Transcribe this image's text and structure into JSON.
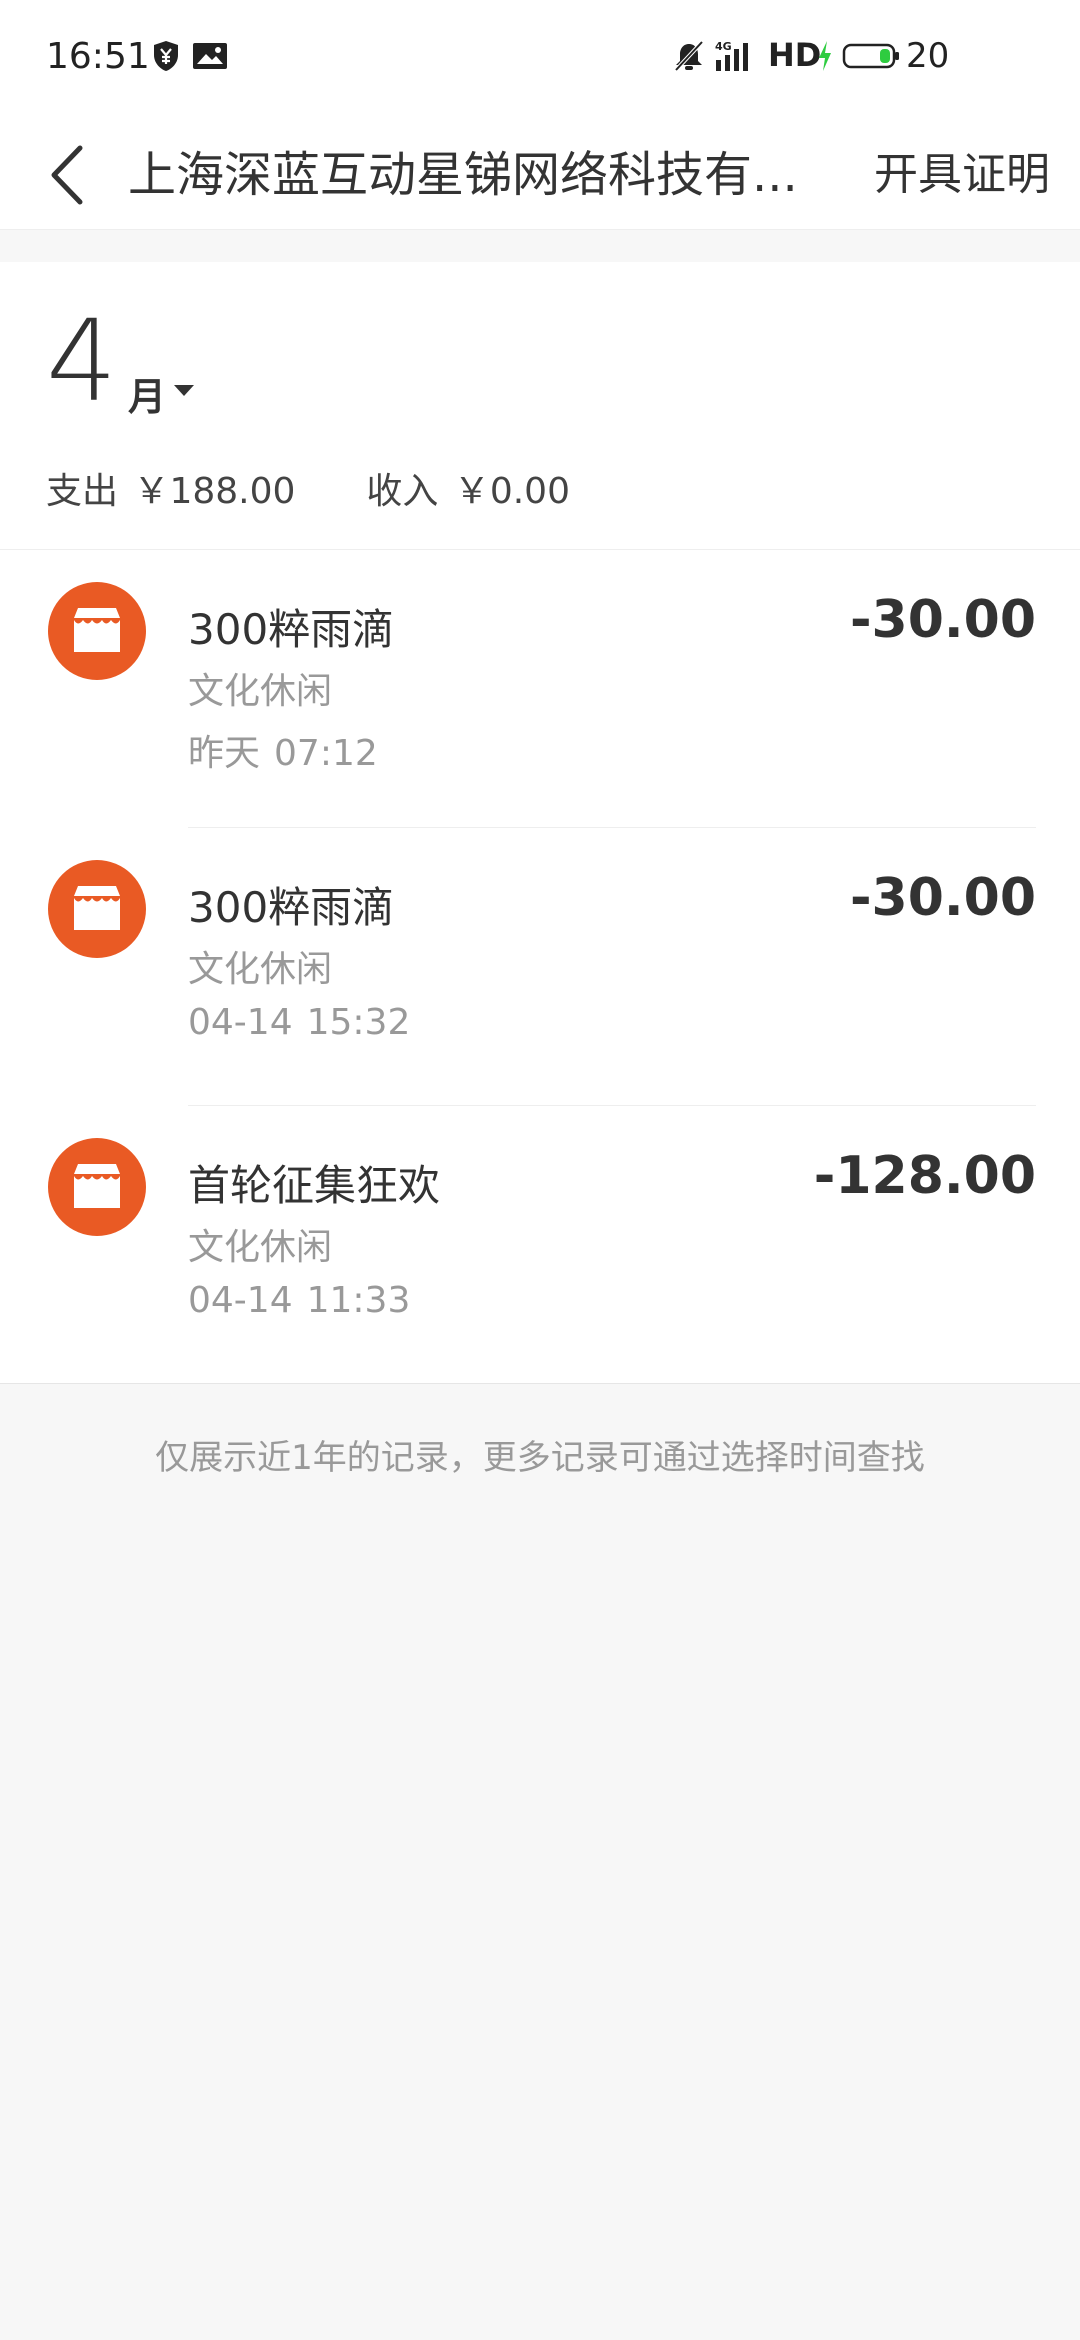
{
  "status_bar": {
    "time": "16:51",
    "battery_level": "20",
    "network": "4G",
    "hd": "HD"
  },
  "header": {
    "title": "上海深蓝互动星锑网络科技有...",
    "action_label": "开具证明"
  },
  "summary": {
    "month_number": "4",
    "month_unit": "月",
    "expense_label": "支出",
    "expense_value": "￥188.00",
    "income_label": "收入",
    "income_value": "￥0.00"
  },
  "transactions": [
    {
      "title": "300粹雨滴",
      "category": "文化休闲",
      "date": "昨天",
      "time": "07:12",
      "amount": "-30.00"
    },
    {
      "title": "300粹雨滴",
      "category": "文化休闲",
      "date": "04-14",
      "time": "15:32",
      "amount": "-30.00"
    },
    {
      "title": "首轮征集狂欢",
      "category": "文化休闲",
      "date": "04-14",
      "time": "11:33",
      "amount": "-128.00"
    }
  ],
  "footer_note": "仅展示近1年的记录，更多记录可通过选择时间查找",
  "colors": {
    "accent": "#e95a24",
    "text_primary": "#333333",
    "text_secondary": "#999999",
    "background": "#f7f7f7"
  }
}
